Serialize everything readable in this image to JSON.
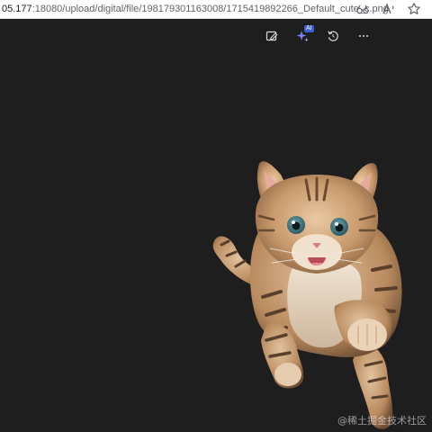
{
  "browser": {
    "url_host": "05.177",
    "url_rest": ":18080/upload/digital/file/198179301163008/1715419892266_Default_cute_c.png",
    "icons": [
      "binoculars-icon",
      "read-aloud-icon",
      "favorite-star-icon"
    ]
  },
  "viewer_toolbar": {
    "ai_badge": "AI",
    "icons": [
      "edit-image-icon",
      "ai-sparkle-icon",
      "rotate-icon",
      "more-options-icon"
    ]
  },
  "image": {
    "subject": "cute kitten leaping",
    "watermark": "@稀土掘金技术社区"
  },
  "colors": {
    "background": "#1e1e1e",
    "address_bar": "#ffffff",
    "accent_sparkle": "#6b6bff"
  }
}
